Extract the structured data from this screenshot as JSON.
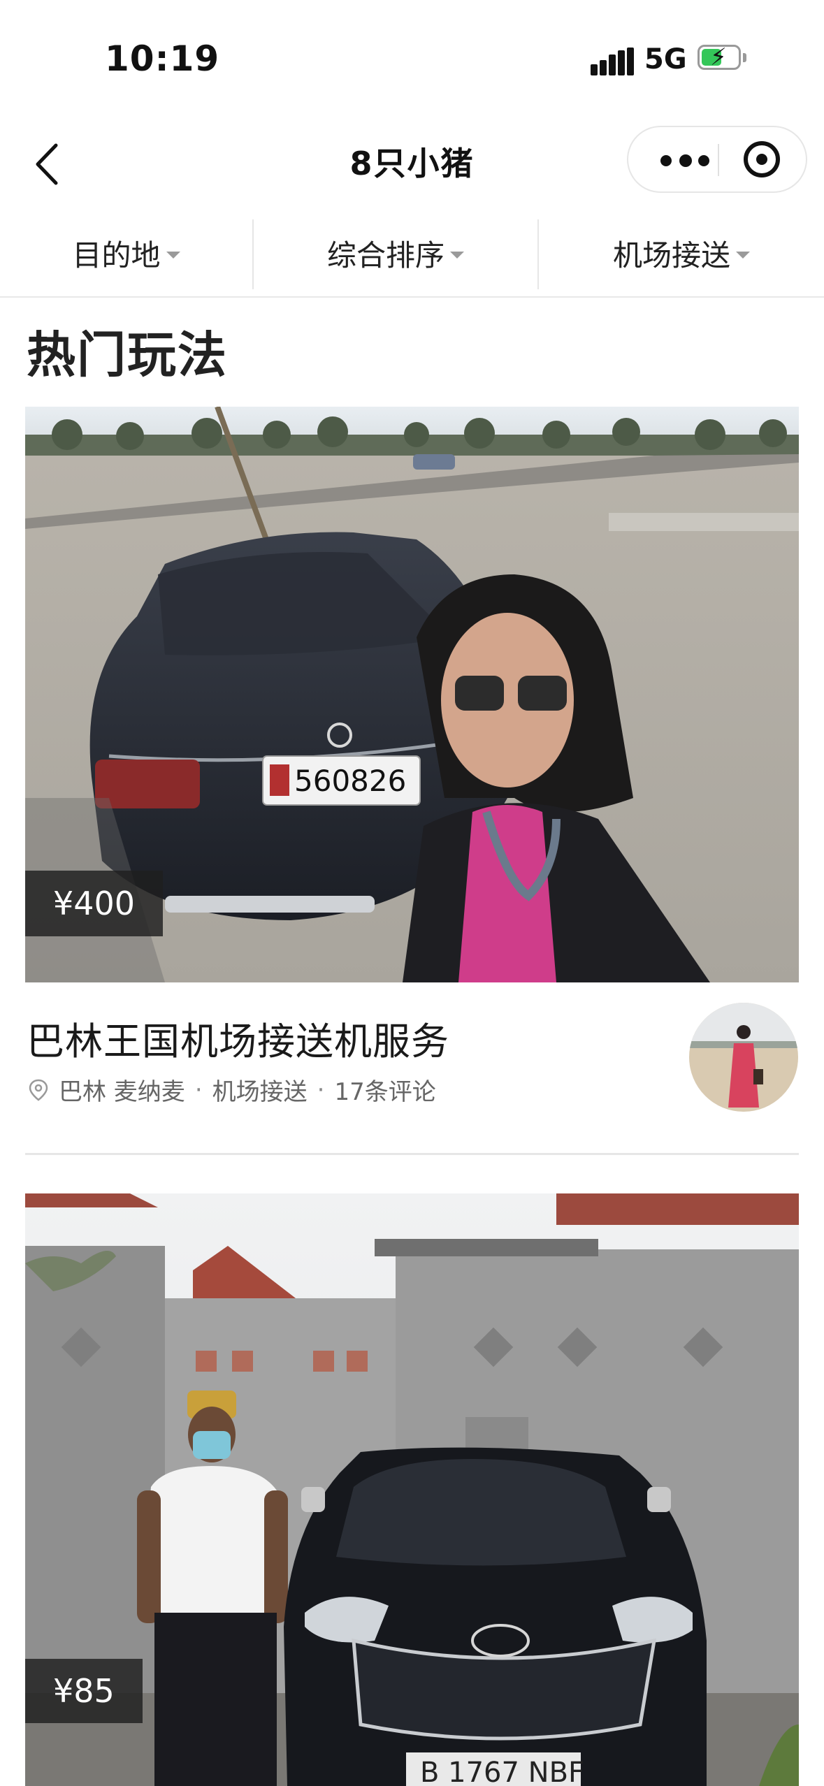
{
  "status_bar": {
    "time": "10:19",
    "network": "5G",
    "battery_state": "charging"
  },
  "nav": {
    "title": "8只小猪",
    "back_icon": "chevron-left-icon",
    "more_icon": "more-dots-icon",
    "close_icon": "target-circle-icon"
  },
  "filters": [
    {
      "label": "目的地"
    },
    {
      "label": "综合排序"
    },
    {
      "label": "机场接送"
    }
  ],
  "section": {
    "title": "热门玩法"
  },
  "items": [
    {
      "price": "¥400",
      "title": "巴林王国机场接送机服务",
      "location": "巴林 麦纳麦",
      "category": "机场接送",
      "reviews": "17条评论",
      "image_plate": "560826"
    },
    {
      "price": "¥85",
      "image_plate": "B 1767 NBF"
    }
  ],
  "colors": {
    "badge_bg": "#1e1e1e",
    "battery_green": "#34c759",
    "divider": "#e6e6e6"
  }
}
